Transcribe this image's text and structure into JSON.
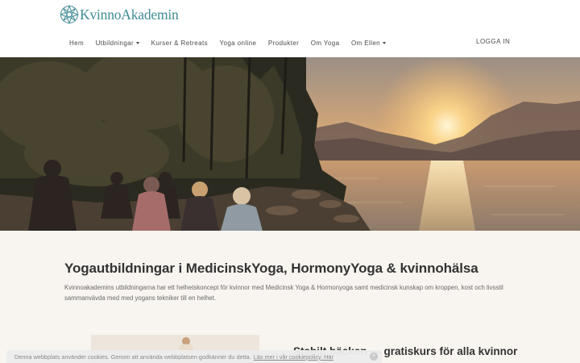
{
  "header": {
    "logo_text": "KvinnoAkademin",
    "nav": [
      {
        "label": "Hem",
        "has_dropdown": false
      },
      {
        "label": "Utbildningar",
        "has_dropdown": true
      },
      {
        "label": "Kurser & Retreats",
        "has_dropdown": false
      },
      {
        "label": "Yoga online",
        "has_dropdown": false
      },
      {
        "label": "Produkter",
        "has_dropdown": false
      },
      {
        "label": "Om Yoga",
        "has_dropdown": false
      },
      {
        "label": "Om Ellen",
        "has_dropdown": true
      }
    ],
    "login_label": "LOGGA IN"
  },
  "hero": {
    "image": "women-meditating-by-lake-at-sunset"
  },
  "main": {
    "headline": "Yogautbildningar i MedicinskYoga, HormonyYoga & kvinnohälsa",
    "intro": "Kvinnoakademins utbildningarna har ett helhetskoncept för kvinnor med Medicinsk Yoga & Hormonyoga samt medicinsk kunskap om kroppen, kost och livsstil sammanvävda med med yogans tekniker till en helhet.",
    "subhead": "Stabilt bäcken — gratiskurs för alla kvinnor"
  },
  "cookie": {
    "text": "Denna webbplats använder cookies. Genom att använda webbplatsen godkänner du detta.",
    "link": "Läs mer i vår cookiepolicy. Här",
    "close": "×"
  },
  "colors": {
    "brand": "#3e8c95",
    "content_bg": "#f8f5f0",
    "text_dark": "#333333"
  }
}
